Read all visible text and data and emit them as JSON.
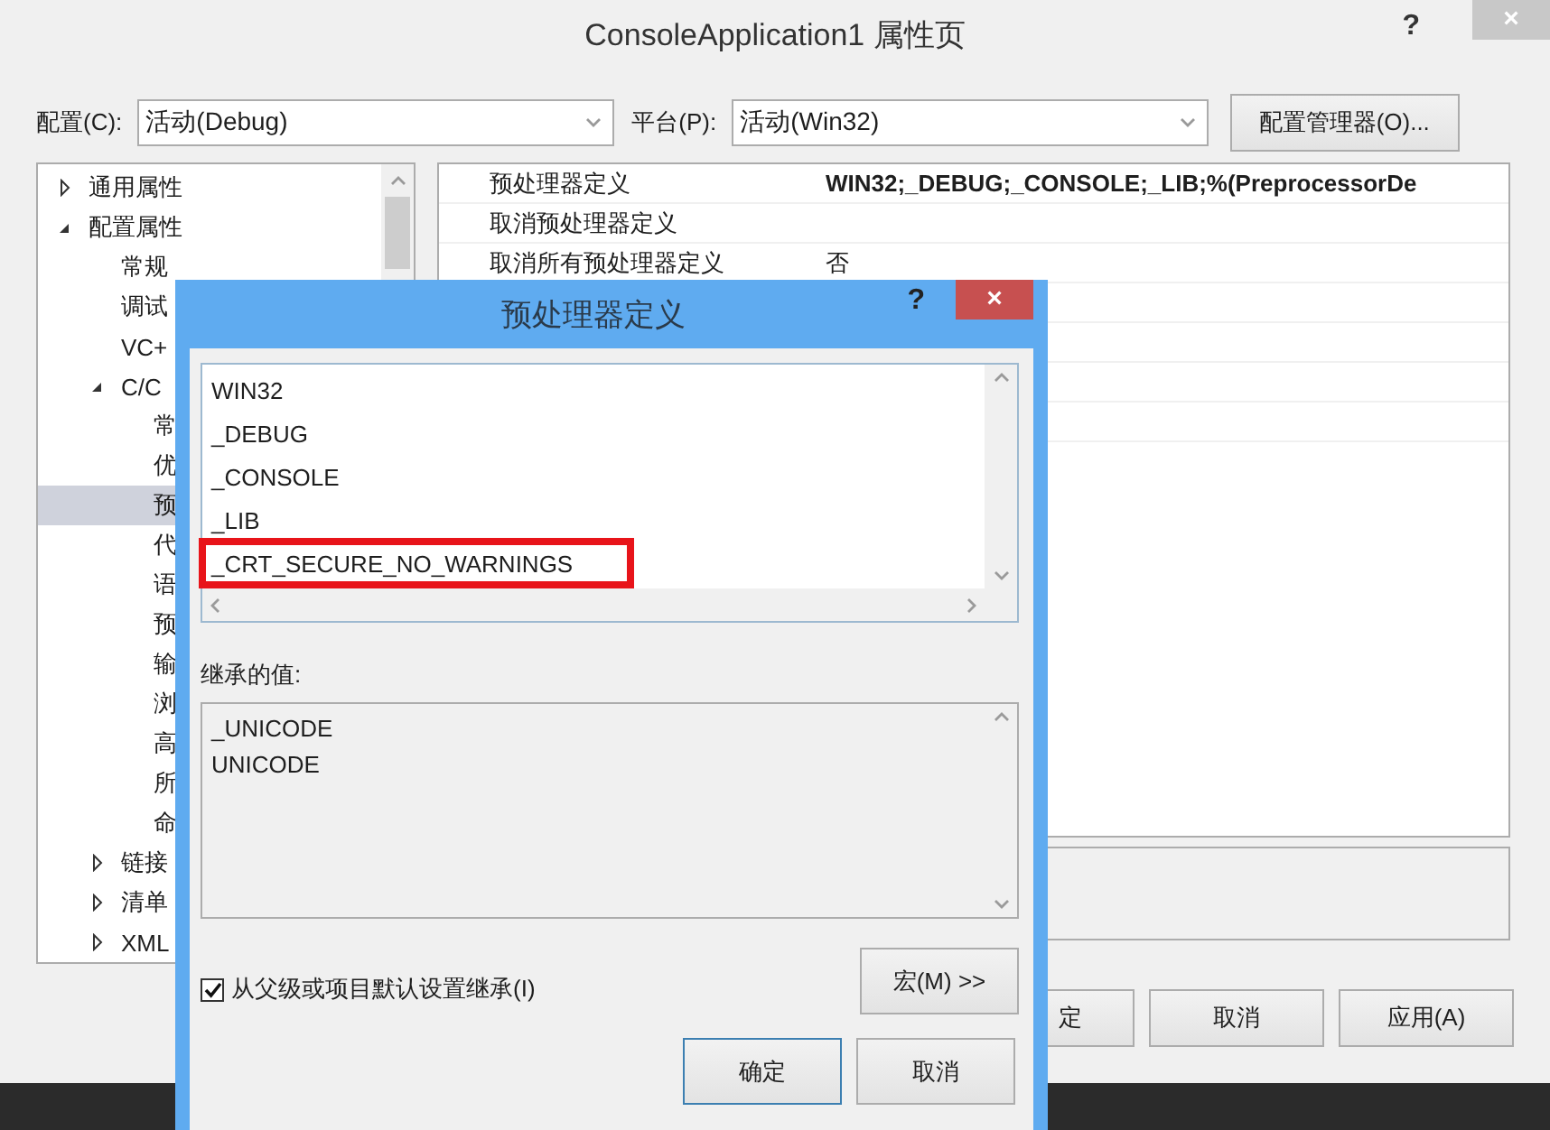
{
  "window": {
    "title": "ConsoleApplication1 属性页",
    "help": "?",
    "close": "×"
  },
  "toolbar": {
    "config_label": "配置(C):",
    "config_value": "活动(Debug)",
    "platform_label": "平台(P):",
    "platform_value": "活动(Win32)",
    "manager_button": "配置管理器(O)..."
  },
  "tree": [
    {
      "label": "通用属性",
      "expanded": false,
      "selected": false
    },
    {
      "label": "配置属性",
      "expanded": true,
      "selected": false,
      "children": [
        {
          "label": "常规",
          "selected": false
        },
        {
          "label": "调试",
          "selected": false
        },
        {
          "label": "VC+",
          "selected": false
        },
        {
          "label": "C/C",
          "expanded": true,
          "selected": false,
          "children": [
            {
              "label": "常",
              "selected": false
            },
            {
              "label": "优",
              "selected": false
            },
            {
              "label": "预",
              "selected": true
            },
            {
              "label": "代",
              "selected": false
            },
            {
              "label": "语",
              "selected": false
            },
            {
              "label": "预",
              "selected": false
            },
            {
              "label": "输",
              "selected": false
            },
            {
              "label": "浏",
              "selected": false
            },
            {
              "label": "高",
              "selected": false
            },
            {
              "label": "所",
              "selected": false
            },
            {
              "label": "命",
              "selected": false
            }
          ]
        },
        {
          "label": "链接",
          "expanded": false,
          "selected": false
        },
        {
          "label": "清单",
          "expanded": false,
          "selected": false
        },
        {
          "label": "XML",
          "expanded": false,
          "selected": false
        }
      ]
    }
  ],
  "properties": [
    {
      "name": "预处理器定义",
      "value": "WIN32;_DEBUG;_CONSOLE;_LIB;%(PreprocessorDe"
    },
    {
      "name": "取消预处理器定义"
    },
    {
      "name": "取消所有预处理器定义",
      "value": "否"
    }
  ],
  "buttons": [
    "定",
    "取消",
    "应用(A)"
  ],
  "dialog": {
    "title": "预处理器定义",
    "help": "?",
    "close": "×",
    "lines": [
      {
        "text": "WIN32",
        "highlighted": false
      },
      {
        "text": "_DEBUG",
        "highlighted": false
      },
      {
        "text": "_CONSOLE",
        "highlighted": false
      },
      {
        "text": "_LIB",
        "highlighted": false
      },
      {
        "text": "_CRT_SECURE_NO_WARNINGS",
        "highlighted": true
      }
    ],
    "inherited_label": "继承的值:",
    "inherited": [
      "_UNICODE",
      "UNICODE"
    ],
    "inherit_checkbox": {
      "label": "从父级或项目默认设置继承(I)",
      "checked": true
    },
    "macro_button": "宏(M) >>",
    "ok_button": "确定",
    "cancel_button": "取消"
  }
}
